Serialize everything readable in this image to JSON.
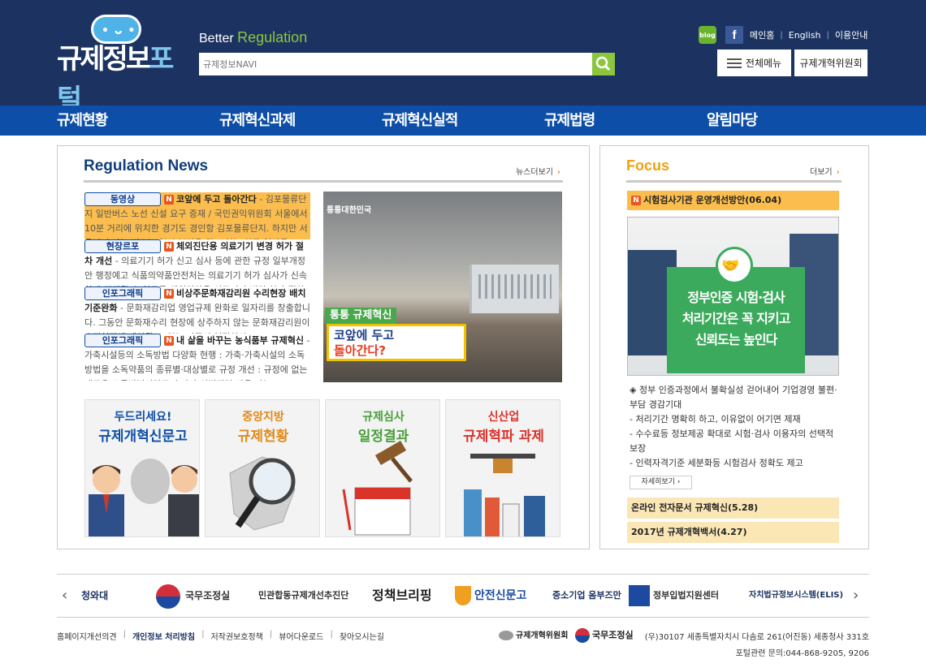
{
  "header": {
    "logo_text_a": "규제정보",
    "logo_text_b": "포털",
    "tagline_a": "Better",
    "tagline_b": "Regulation",
    "search_placeholder": "규제정보NAVI",
    "links": [
      "메인홈",
      "English",
      "이용안내"
    ],
    "blog_label": "blog",
    "facebook_label": "f",
    "all_menu_label": "전체메뉴",
    "committee_label": "규제개혁위원회"
  },
  "nav": [
    "규제현황",
    "규제혁신과제",
    "규제혁신실적",
    "규제법령",
    "알림마당"
  ],
  "news": {
    "title": "Regulation News",
    "more_label": "뉴스더보기",
    "items": [
      {
        "category": "동영상",
        "title": "코앞에 두고 돌아간다",
        "text": " - 김포물류단지 일반버스 노선 신설 요구 증재 / 국민권익위원회 서울에서 10분 거리에 위치한 경기도 경인항 김포물류단지. 하지만 서울까지 가는 버스는 없어 불편을 겪고 있는 입주 업체들"
      },
      {
        "category": "현장르포",
        "title": "체외진단용 의료기기 변경 허가 절차 개선",
        "text": " - 의료기기 허가 신고 심사 등에 관한 규정 일부개정안 행정예고 식품의약품안전처는 의료기기 허가 심사가 신속하게 진행될 수 있도록 체외진단용 의료기기 변경 허가 절차를"
      },
      {
        "category": "인포그래픽",
        "title": "비상주문화재감리원 수리현장 배치 기준완화",
        "text": " - 문화재감리업 영업규제 완화로 일자리를 창출합니다. 그동안 문화재수리 현장에 상주하지 않는 문화재감리원이 수리현장에 배치될 수 있는 기준이 엄격하여"
      },
      {
        "category": "인포그래픽",
        "title": "내 삶을 바꾸는 농식품부 규제혁신",
        "text": " - 가축시설등의 소독방법 다양화 현행 : 가축·가축시설의 소독방법을 소독약품의 종류별·대상별로 규정 개선 : 규정에 없는 새로운 소독방법이라도 효과가 인정되면 사용 가능"
      }
    ],
    "photo": {
      "brand": "통통대한민국",
      "tag": "통통 규제혁신",
      "caption_a": "코앞에 두고",
      "caption_b": "돌아간다?"
    }
  },
  "banners": [
    {
      "line1": "두드리세요!",
      "line2": "규제개혁신문고",
      "color1": "#0d4fa8",
      "color2": "#0d4fa8"
    },
    {
      "line1": "중앙지방",
      "line2": "규제현황",
      "color1": "#e08a18",
      "color2": "#e08a18"
    },
    {
      "line1": "규제심사",
      "line2": "일정결과",
      "color1": "#4a9e3a",
      "color2": "#4a9e3a"
    },
    {
      "line1": "신산업",
      "line2": "규제혁파 과제",
      "color1": "#d9332a",
      "color2": "#d9332a"
    }
  ],
  "focus": {
    "title": "Focus",
    "more_label": "더보기",
    "headline": "시험검사기관 운영개선방안(06.04)",
    "image_text": [
      "정부인증 시험·검사",
      "처리기간은 꼭 지키고",
      "신뢰도는 높인다"
    ],
    "desc": [
      "◈ 정부 인증과정에서 불확실성 걷어내어 기업경영 불편·부담 경감기대",
      "- 처리기간 명확히 하고, 이유없이 어기면 제재",
      "- 수수료등 정보제공 확대로 시험·검사 이용자의 선택적 보장",
      "- 인력자격기준 세분화등 시험검사 정확도 제고"
    ],
    "detail_label": "자세히보기",
    "links": [
      "온라인 전자문서 규제혁신(5.28)",
      "2017년 규제개혁백서(4.27)"
    ]
  },
  "partners": [
    "청와대",
    "국무조정실",
    "민관합동규제개선추진단",
    "정책브리핑",
    "안전신문고",
    "중소기업 옴부즈만",
    "정부입법지원센터",
    "자치법규정보시스템(ELIS)"
  ],
  "footer": {
    "links": [
      "홈페이지개선의견",
      "개인정보 처리방침",
      "저작권보호정책",
      "뷰어다운로드",
      "찾아오시는길"
    ],
    "logos": [
      "규제개혁위원회",
      "국무조정실"
    ],
    "address": "(우)30107 세종특별자치시 다솜로 261(어진동) 세종청사 331호",
    "contact": "포털관련 문의:044-868-9205, 9206"
  },
  "colors": {
    "header_bg": "#1c3361",
    "nav_bg": "#0d4fa8",
    "accent_green": "#8cc63f",
    "highlight": "#fbbd4e"
  }
}
